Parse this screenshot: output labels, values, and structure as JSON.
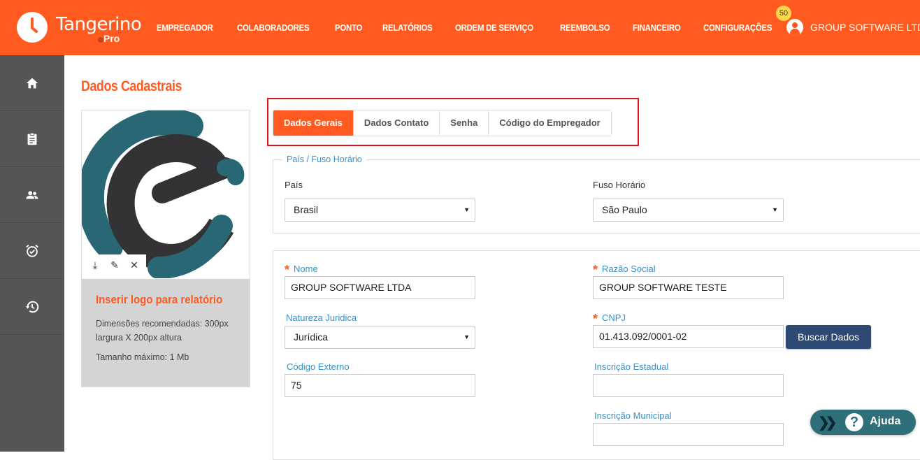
{
  "header": {
    "brand": "Tangerino",
    "brand_sub": "Pro",
    "nav": [
      "EMPREGADOR",
      "COLABORADORES",
      "PONTO",
      "RELATÓRIOS",
      "ORDEM DE SERVIÇO",
      "REEMBOLSO",
      "FINANCEIRO",
      "CONFIGURAÇÕES"
    ],
    "notification_count": "50",
    "user_name": "GROUP SOFTWARE LTDA"
  },
  "sidebar": {
    "icons": [
      "home-icon",
      "clipboard-icon",
      "people-icon",
      "alarm-check-icon",
      "history-icon"
    ]
  },
  "page": {
    "title": "Dados Cadastrais"
  },
  "logo_card": {
    "tool_icons": [
      "download-icon",
      "pencil-icon",
      "close-icon"
    ],
    "tools": [
      "⤓",
      "✎",
      "✕"
    ],
    "info_title": "Inserir logo para relatório",
    "info_dims": "Dimensões recomendadas: 300px largura X 200px altura",
    "info_max": "Tamanho máximo: 1 Mb"
  },
  "tabs": [
    {
      "label": "Dados Gerais",
      "active": true
    },
    {
      "label": "Dados Contato",
      "active": false
    },
    {
      "label": "Senha",
      "active": false
    },
    {
      "label": "Código do Empregador",
      "active": false
    }
  ],
  "timezone_group": {
    "legend": "País / Fuso Horário",
    "country_label": "País",
    "country_value": "Brasil",
    "timezone_label": "Fuso Horário",
    "timezone_value": "São Paulo"
  },
  "company_form": {
    "nome_label": "Nome",
    "nome_value": "GROUP SOFTWARE LTDA",
    "razao_label": "Razão Social",
    "razao_value": "GROUP SOFTWARE TESTE",
    "natureza_label": "Natureza Juridica",
    "natureza_value": "Jurídica",
    "cnpj_label": "CNPJ",
    "cnpj_value": "01.413.092/0001-02",
    "buscar_label": "Buscar Dados",
    "codigo_label": "Código Externo",
    "codigo_value": "75",
    "ie_label": "Inscrição Estadual",
    "ie_value": "",
    "im_label": "Inscrição Municipal",
    "im_value": ""
  },
  "help": {
    "label": "Ajuda"
  },
  "colors": {
    "brand_orange": "#ff5a1f",
    "sidebar_gray": "#555555",
    "label_blue": "#3a8fc4",
    "button_navy": "#2c4a73",
    "help_teal": "#2f6f7a",
    "highlight_red": "#d9141c"
  }
}
